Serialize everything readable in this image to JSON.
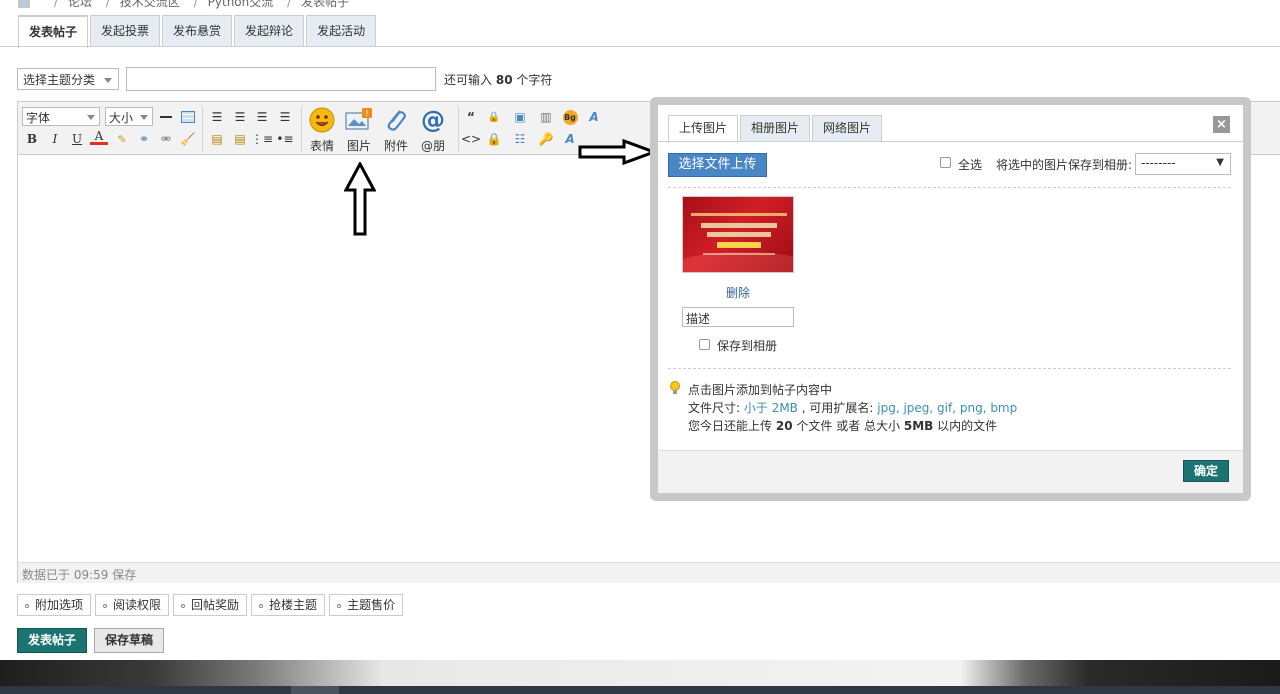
{
  "breadcrumb": [
    "论坛",
    "技术交流区",
    "Python交流",
    "发表帖子"
  ],
  "post_tabs": [
    "发表帖子",
    "发起投票",
    "发布悬赏",
    "发起辩论",
    "发起活动"
  ],
  "subject": {
    "category_select": "选择主题分类",
    "char_prefix": "还可输入",
    "char_count": "80",
    "char_suffix": "个字符"
  },
  "toolbar": {
    "font_select": "字体",
    "size_select": "大小",
    "emoji_label": "表情",
    "image_label": "图片",
    "attach_label": "附件",
    "at_label": "@朋"
  },
  "editor": {
    "status": "数据已于 09:59 保存"
  },
  "dialog": {
    "tabs": [
      "上传图片",
      "相册图片",
      "网络图片"
    ],
    "close": "×",
    "upload_button": "选择文件上传",
    "select_all": "全选",
    "save_to_album_label": "将选中的图片保存到相册:",
    "album_select": "--------",
    "delete_link": "删除",
    "description_value": "描述",
    "save_album_checkbox": "保存到相册",
    "tip_line1": "点击图片添加到帖子内容中",
    "tip_line2_prefix": "文件尺寸:",
    "tip_line2_size": "小于 2MB",
    "tip_line2_mid": ", 可用扩展名:",
    "tip_line2_ext": "jpg, jpeg, gif, png, bmp",
    "tip_line3_a": "您今日还能上传",
    "tip_line3_count": "20",
    "tip_line3_b": "个文件 或者 总大小",
    "tip_line3_size": "5MB",
    "tip_line3_c": "以内的文件",
    "ok_button": "确定"
  },
  "options": [
    "附加选项",
    "阅读权限",
    "回帖奖励",
    "抢楼主题",
    "主题售价"
  ],
  "actions": {
    "post_button": "发表帖子",
    "draft_button": "保存草稿"
  },
  "colors": {
    "primary_button": "#1c7472",
    "upload_button": "#4a86c6",
    "link": "#336699",
    "tab_bg": "#e5edf2"
  }
}
